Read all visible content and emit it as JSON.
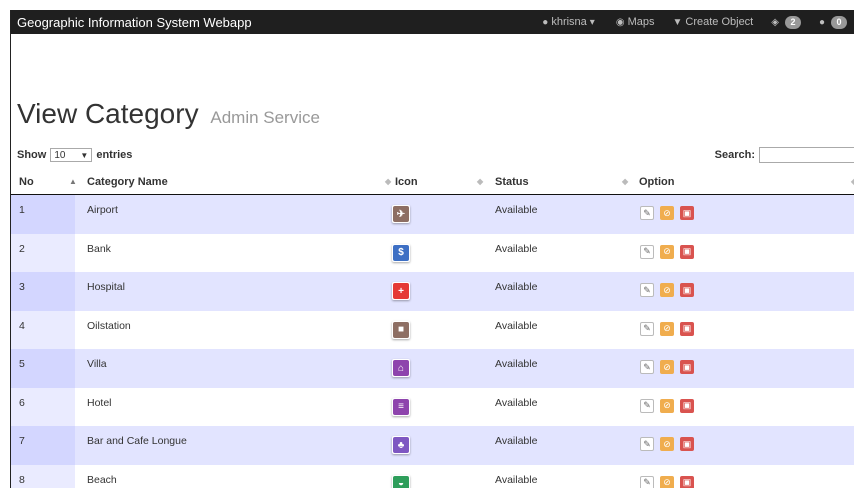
{
  "navbar": {
    "brand": "Geographic Information System Webapp",
    "user_label": "khrisna",
    "maps_label": "Maps",
    "create_label": "Create Object",
    "messages_count": "2",
    "users_count": "0"
  },
  "page": {
    "title": "View Category",
    "subtitle": "Admin Service"
  },
  "table_controls": {
    "show_label": "Show",
    "page_size": "10",
    "entries_label": "entries",
    "search_label": "Search:"
  },
  "table": {
    "columns": [
      "No",
      "Category Name",
      "Icon",
      "Status",
      "Option"
    ],
    "rows": [
      {
        "no": "1",
        "name": "Airport",
        "status": "Available",
        "icon": "airport-icon",
        "color": "#8d6e63"
      },
      {
        "no": "2",
        "name": "Bank",
        "status": "Available",
        "icon": "bank-icon",
        "color": "#3d6fc4"
      },
      {
        "no": "3",
        "name": "Hospital",
        "status": "Available",
        "icon": "hospital-icon",
        "color": "#e53935"
      },
      {
        "no": "4",
        "name": "Oilstation",
        "status": "Available",
        "icon": "oilstation-icon",
        "color": "#8d6e63"
      },
      {
        "no": "5",
        "name": "Villa",
        "status": "Available",
        "icon": "villa-icon",
        "color": "#8e44ad"
      },
      {
        "no": "6",
        "name": "Hotel",
        "status": "Available",
        "icon": "hotel-icon",
        "color": "#8e44ad"
      },
      {
        "no": "7",
        "name": "Bar and Cafe Longue",
        "status": "Available",
        "icon": "bar-cafe-icon",
        "color": "#7e57c2"
      },
      {
        "no": "8",
        "name": "Beach",
        "status": "Available",
        "icon": "beach-icon",
        "color": "#2e9e5b"
      }
    ]
  },
  "colors": {
    "navbar_bg": "#1f1f1f",
    "row_odd": "#e2e4ff",
    "edit_button": "#ffffff",
    "disable_button": "#f0ad4e",
    "delete_button": "#d9534f"
  }
}
